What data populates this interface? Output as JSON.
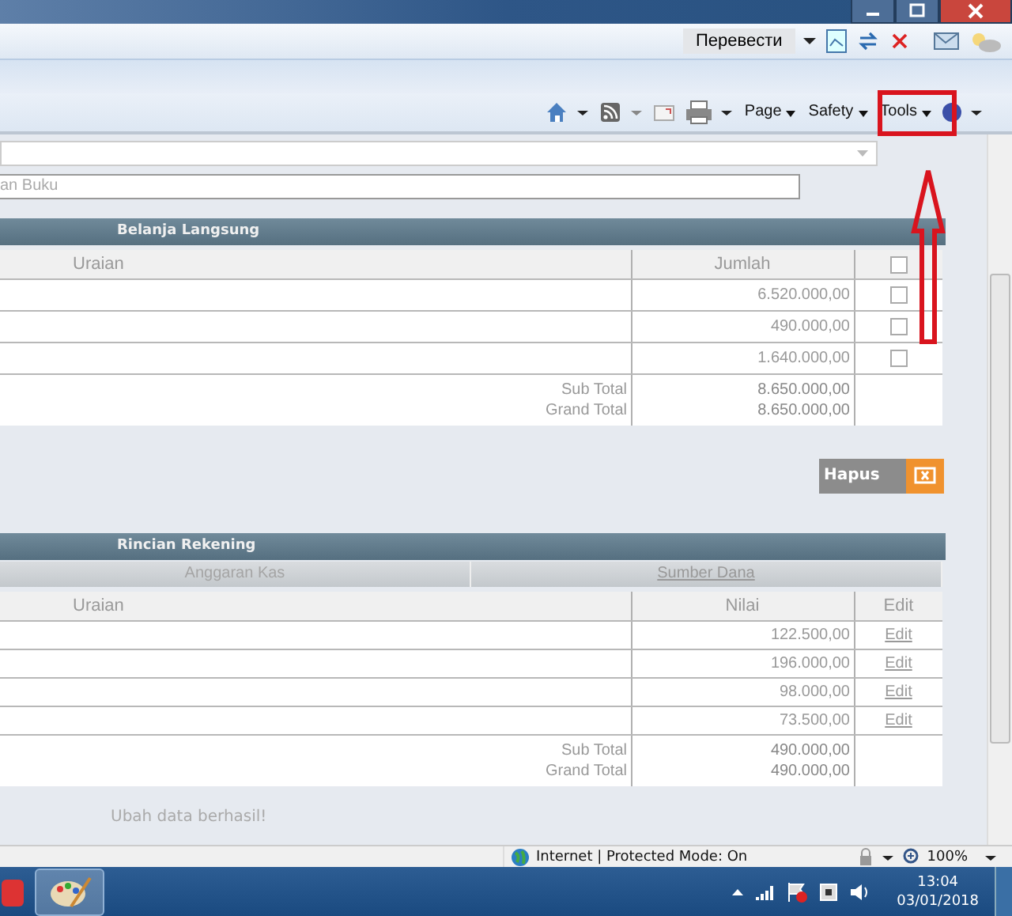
{
  "browser": {
    "translate_button": "Перевести",
    "command_bar": [
      {
        "label": "Page"
      },
      {
        "label": "Safety"
      },
      {
        "label": "Tools"
      }
    ]
  },
  "form": {
    "text_field": {
      "value": "an Buku"
    }
  },
  "belanja": {
    "title": "Belanja Langsung",
    "columns": [
      "Uraian",
      "Jumlah"
    ],
    "header_checked": false,
    "rows": [
      {
        "jumlah": "6.520.000,00",
        "checked": false
      },
      {
        "jumlah": "490.000,00",
        "checked": false
      },
      {
        "jumlah": "1.640.000,00",
        "checked": false
      }
    ],
    "totals": [
      {
        "label": "Sub Total",
        "value": "8.650.000,00"
      },
      {
        "label": "Grand Total",
        "value": "8.650.000,00"
      }
    ]
  },
  "delete_button": "Hapus",
  "rincian": {
    "title": "Rincian Rekening",
    "tabs": [
      {
        "label": "Anggaran Kas",
        "selected": false
      },
      {
        "label": "Sumber Dana",
        "selected": true
      }
    ],
    "columns": [
      "Uraian",
      "Nilai",
      "Edit"
    ],
    "rows": [
      {
        "nilai": "122.500,00",
        "action": "Edit"
      },
      {
        "nilai": "196.000,00",
        "action": "Edit"
      },
      {
        "nilai": "98.000,00",
        "action": "Edit"
      },
      {
        "nilai": "73.500,00",
        "action": "Edit"
      }
    ],
    "totals": [
      {
        "label": "Sub Total",
        "value": "490.000,00"
      },
      {
        "label": "Grand Total",
        "value": "490.000,00"
      }
    ]
  },
  "message": "Ubah data berhasil!",
  "status_bar": {
    "zone": "Internet | Protected Mode: On",
    "zoom": "100%"
  },
  "taskbar": {
    "time": "13:04",
    "date": "03/01/2018"
  }
}
